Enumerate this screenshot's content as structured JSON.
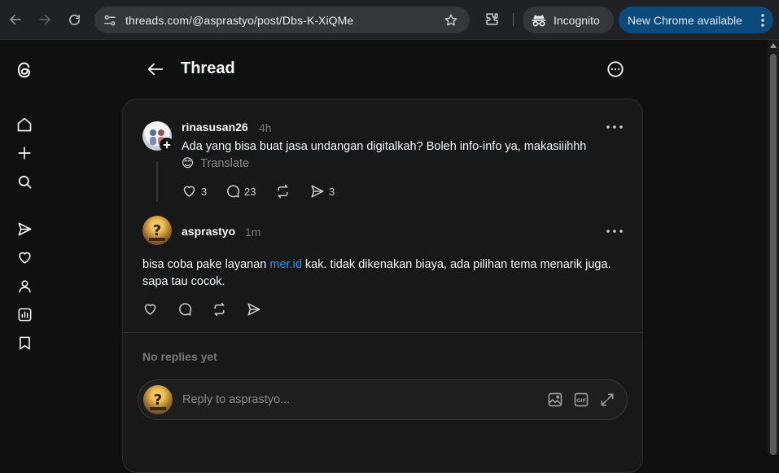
{
  "browser": {
    "url": "threads.com/@asprastyo/post/Dbs-K-XiQMe",
    "incognito_label": "Incognito",
    "update_label": "New Chrome available"
  },
  "header": {
    "title": "Thread"
  },
  "original_post": {
    "username": "rinasusan26",
    "time": "4h",
    "text": "Ada yang bisa buat jasa undangan digitalkah? Boleh info-info ya, makasiiihhh",
    "emoji": "😊",
    "translate_label": "Translate",
    "likes": "3",
    "replies": "23",
    "shares": "3"
  },
  "reply_post": {
    "username": "asprastyo",
    "time": "1m",
    "text_before_link": "bisa coba pake layanan ",
    "link_text": "mer.id",
    "text_after_link": " kak. tidak dikenakan biaya, ada pilihan tema menarik juga. sapa tau cocok."
  },
  "replies_section": {
    "empty_label": "No replies yet"
  },
  "composer": {
    "placeholder": "Reply to asprastyo..."
  }
}
